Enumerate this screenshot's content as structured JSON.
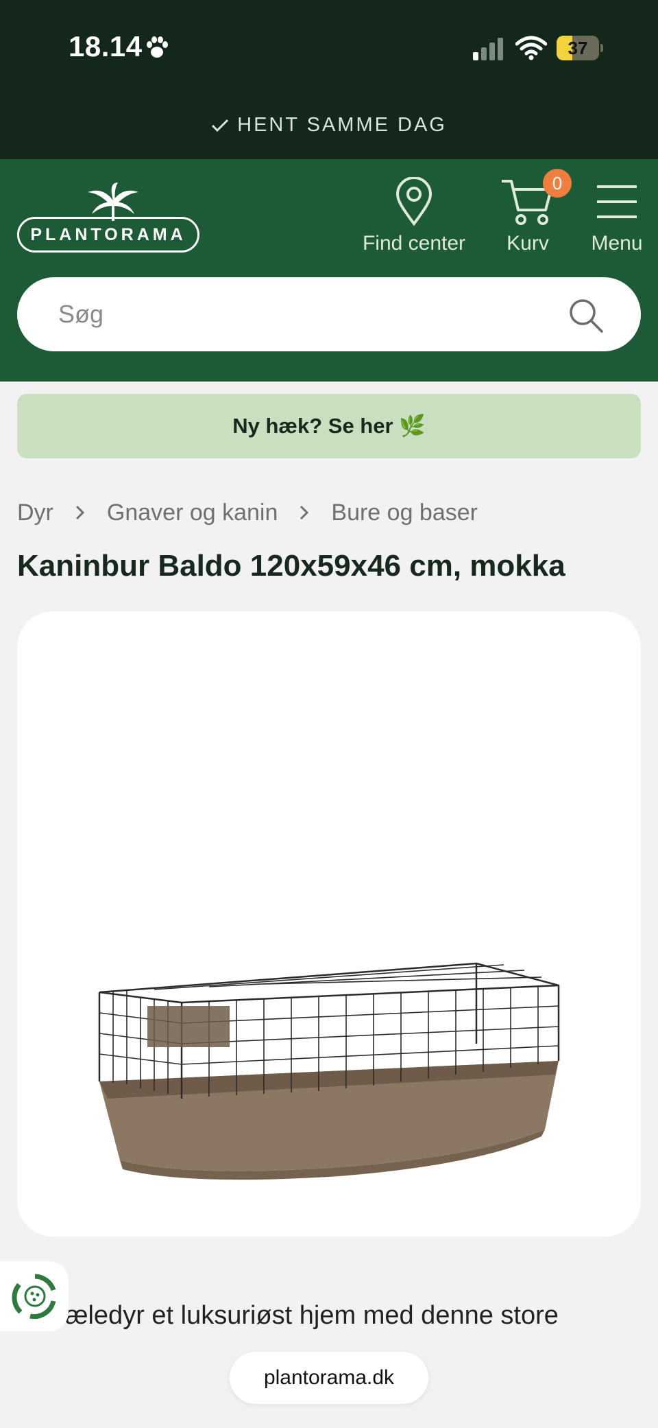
{
  "status_bar": {
    "time": "18.14",
    "battery_level": "37",
    "battery_fraction": 0.37
  },
  "promo": {
    "text": "HENT SAMME DAG"
  },
  "header": {
    "logo_text": "PLANTORAMA",
    "find_center_label": "Find center",
    "cart_label": "Kurv",
    "cart_count": "0",
    "menu_label": "Menu"
  },
  "search": {
    "placeholder": "Søg"
  },
  "banner": {
    "text": "Ny hæk? Se her 🌿"
  },
  "breadcrumb": {
    "items": [
      "Dyr",
      "Gnaver og kanin",
      "Bure og baser"
    ]
  },
  "product": {
    "title": "Kaninbur Baldo 120x59x46 cm, mokka",
    "description_visible": "dit kæledyr et luksuriøst hjem med denne store"
  },
  "browser": {
    "url": "plantorama.dk"
  },
  "colors": {
    "topbar": "#13281b",
    "header": "#1c5b35",
    "banner": "#c8dfc0",
    "cart_badge": "#f07e3e",
    "title": "#17291d"
  }
}
